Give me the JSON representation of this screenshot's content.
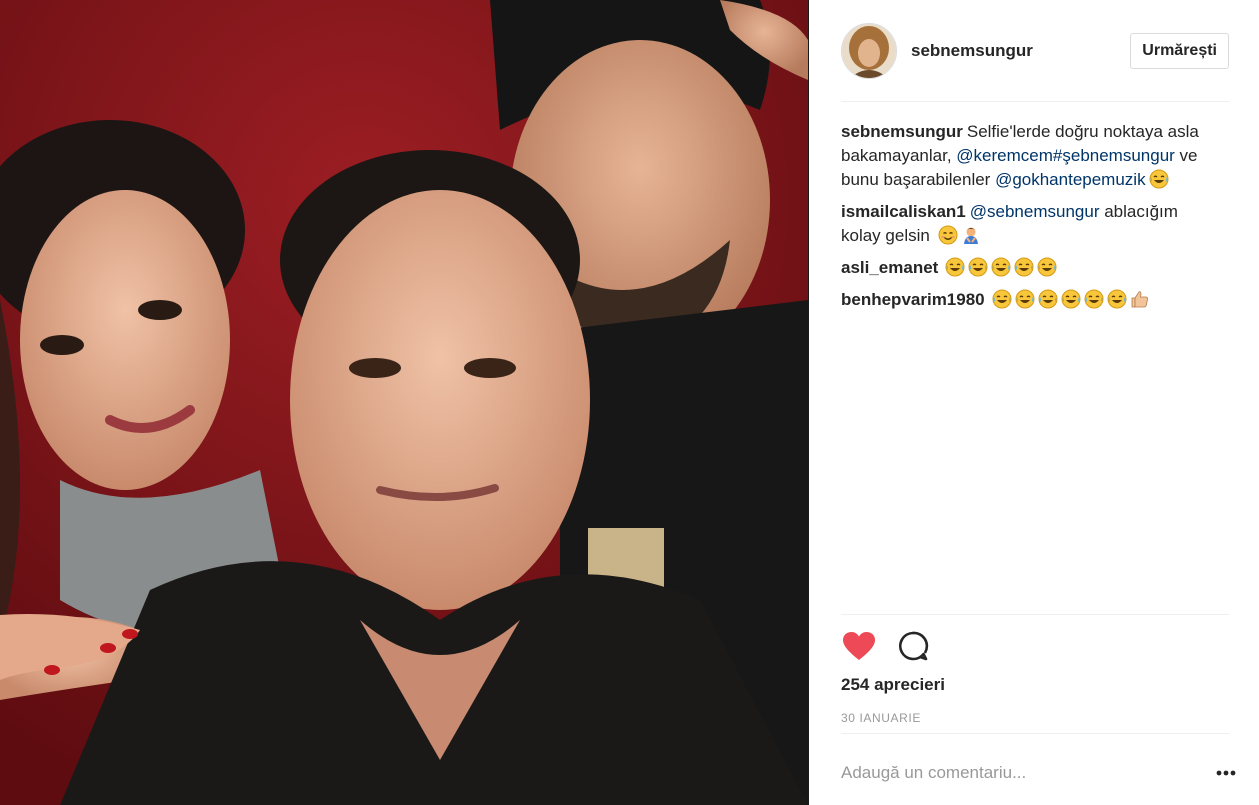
{
  "post": {
    "photo_alt": "Selfie photo",
    "author": {
      "username": "sebnemsungur",
      "follow_label": "Urmărești"
    },
    "comments": [
      {
        "username": "sebnemsungur",
        "parts": [
          {
            "type": "text",
            "value": "Selfie'lerde doğru noktaya asla bakamayanlar, "
          },
          {
            "type": "mention",
            "value": "@keremcem"
          },
          {
            "type": "mention",
            "value": "#şebnemsungur"
          },
          {
            "type": "text",
            "value": " ve bunu başarabilenler "
          },
          {
            "type": "mention",
            "value": "@gokhantepemuzik"
          }
        ],
        "emojis": [
          "tears-of-joy"
        ]
      },
      {
        "username": "ismailcaliskan1",
        "parts": [
          {
            "type": "mention",
            "value": "@sebnemsungur"
          },
          {
            "type": "text",
            "value": " ablacığım kolay gelsin "
          }
        ],
        "emojis": [
          "smiling-face",
          "person-bowing"
        ]
      },
      {
        "username": "asli_emanet",
        "parts": [],
        "emojis": [
          "tears-of-joy",
          "tears-of-joy",
          "tears-of-joy",
          "tears-of-joy",
          "tears-of-joy"
        ]
      },
      {
        "username": "benhepvarim1980",
        "parts": [],
        "emojis": [
          "tears-of-joy",
          "tears-of-joy",
          "tears-of-joy",
          "tears-of-joy",
          "tears-of-joy",
          "tears-of-joy",
          "thumbs-up"
        ]
      }
    ],
    "likes_label": "254 aprecieri",
    "date_label": "30 IANUARIE",
    "comment_placeholder": "Adaugă un comentariu...",
    "colors": {
      "like": "#ed4956",
      "mention": "#003569",
      "muted": "#999999",
      "text": "#262626",
      "border": "#efefef"
    },
    "icons": {
      "like": "heart-icon",
      "comment": "comment-bubble-icon",
      "more": "more-options-icon"
    }
  }
}
